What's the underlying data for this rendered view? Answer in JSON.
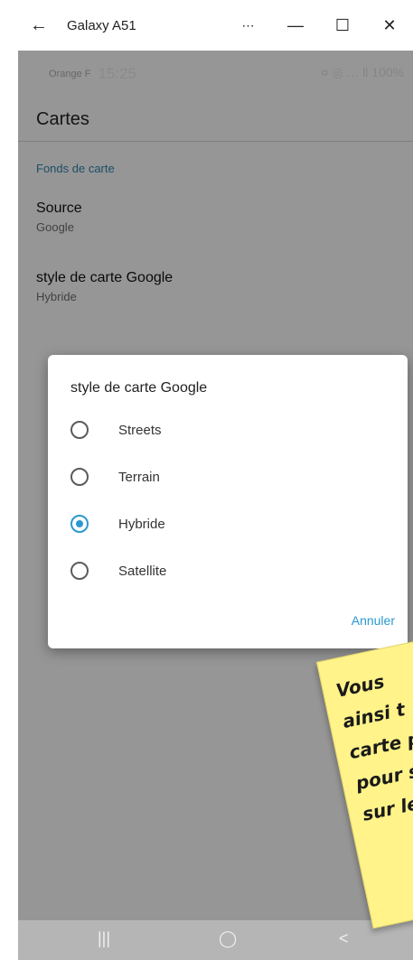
{
  "window": {
    "title": "Galaxy A51",
    "back_icon": "←",
    "more_icon": "⋯",
    "minimize_icon": "—",
    "maximize_icon": "☐",
    "close_icon": "✕"
  },
  "statusbar": {
    "carrier": "Orange F",
    "time": "15:25",
    "battery": "100%",
    "status_icons_text": "¤ ◎ … ll 100%"
  },
  "screen": {
    "title": "Cartes"
  },
  "section_basemap": {
    "header": "Fonds de carte"
  },
  "pref_source": {
    "title": "Source",
    "summary": "Google"
  },
  "pref_style": {
    "title": "style de carte Google",
    "summary": "Hybride"
  },
  "dialog": {
    "title": "style de carte Google",
    "options": [
      {
        "label": "Streets",
        "selected": false
      },
      {
        "label": "Terrain",
        "selected": false
      },
      {
        "label": "Hybride",
        "selected": true
      },
      {
        "label": "Satellite",
        "selected": false
      }
    ],
    "cancel_label": "Annuler"
  },
  "navbar": {
    "recent_icon": "|||",
    "home_icon": "◯",
    "back_icon": "<"
  },
  "note": {
    "text": "Vous\nainsi t\ncarte pl\npour s\nsur le"
  },
  "colors": {
    "accent": "#2a98d0",
    "header_text": "#2f7fa6",
    "note_bg": "#fff38a"
  }
}
